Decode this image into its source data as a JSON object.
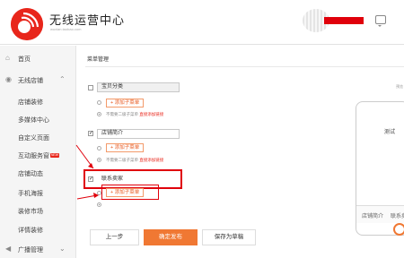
{
  "header": {
    "title": "无线运营中心",
    "url": "wuxian.taobao.com"
  },
  "sidebar": {
    "home": "首页",
    "wireless": "无线店铺",
    "items": [
      "店铺装修",
      "多媒体中心",
      "自定义页面",
      "互动服务窗",
      "店铺动态",
      "手机海报",
      "装修市场",
      "详情装修"
    ],
    "broadcast": "广播管理",
    "new_badge": "NEW"
  },
  "main": {
    "section_title": "菜单管理",
    "menus": [
      {
        "label": "宝贝分类",
        "checked": false,
        "add_button": "+ 添加子菜单",
        "note_prefix": "不需要二级子菜单",
        "note_link": "直接添加链接"
      },
      {
        "label": "店铺简介",
        "checked": true,
        "add_button": "+ 添加子菜单",
        "note_prefix": "不需要二级子菜单",
        "note_link": "直接添加链接"
      },
      {
        "label": "联系卖家",
        "checked": true,
        "add_button": "+ 添加子菜单"
      }
    ],
    "buttons": {
      "prev": "上一步",
      "publish": "确定发布",
      "save_draft": "保存为草稿"
    }
  },
  "preview": {
    "tiny_label": "预览",
    "center_text": "测试",
    "tabs": [
      "店铺简介",
      "联系卖家"
    ]
  }
}
